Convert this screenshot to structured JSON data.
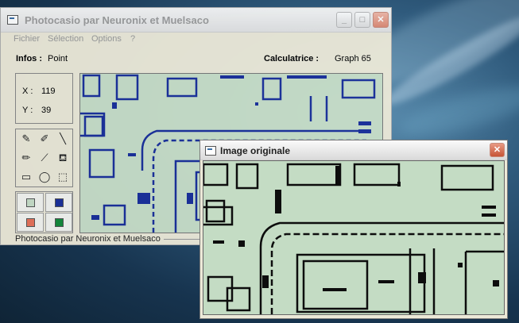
{
  "main_window": {
    "title": "Photocasio par Neuronix et Muelsaco",
    "controls": {
      "minimize": "_",
      "maximize": "□",
      "close": "✕"
    }
  },
  "menu": [
    {
      "label": "Fichier"
    },
    {
      "label": "Sélection"
    },
    {
      "label": "Options"
    },
    {
      "label": "?"
    }
  ],
  "infos": {
    "label": "Infos :",
    "value": "Point"
  },
  "calculator": {
    "label": "Calculatrice :",
    "value": "Graph 65"
  },
  "coords": {
    "x_label": "X :",
    "x_value": "119",
    "y_label": "Y :",
    "y_value": "39"
  },
  "tools": [
    {
      "icon": "pencil-icon",
      "glyph": "✎"
    },
    {
      "icon": "pen-icon",
      "glyph": "✐"
    },
    {
      "icon": "line-icon",
      "glyph": "╲"
    },
    {
      "icon": "brush-icon",
      "glyph": "✏"
    },
    {
      "icon": "eyedropper-icon",
      "glyph": "⟋"
    },
    {
      "icon": "fill-bucket-icon",
      "glyph": "⛾"
    },
    {
      "icon": "rectangle-icon",
      "glyph": "▭"
    },
    {
      "icon": "ellipse-icon",
      "glyph": "◯"
    },
    {
      "icon": "select-rect-icon",
      "glyph": "⬚"
    }
  ],
  "colors": {
    "background": "#c8dec8",
    "foreground_blue": "#1a2f9a",
    "highlight_red": "#e8735a",
    "accent_green": "#138a3a",
    "pixel_ink": "#0d0d0d"
  },
  "status_text": "Photocasio par Neuronix et Muelsaco",
  "original_window": {
    "title": "Image originale",
    "close": "✕"
  }
}
